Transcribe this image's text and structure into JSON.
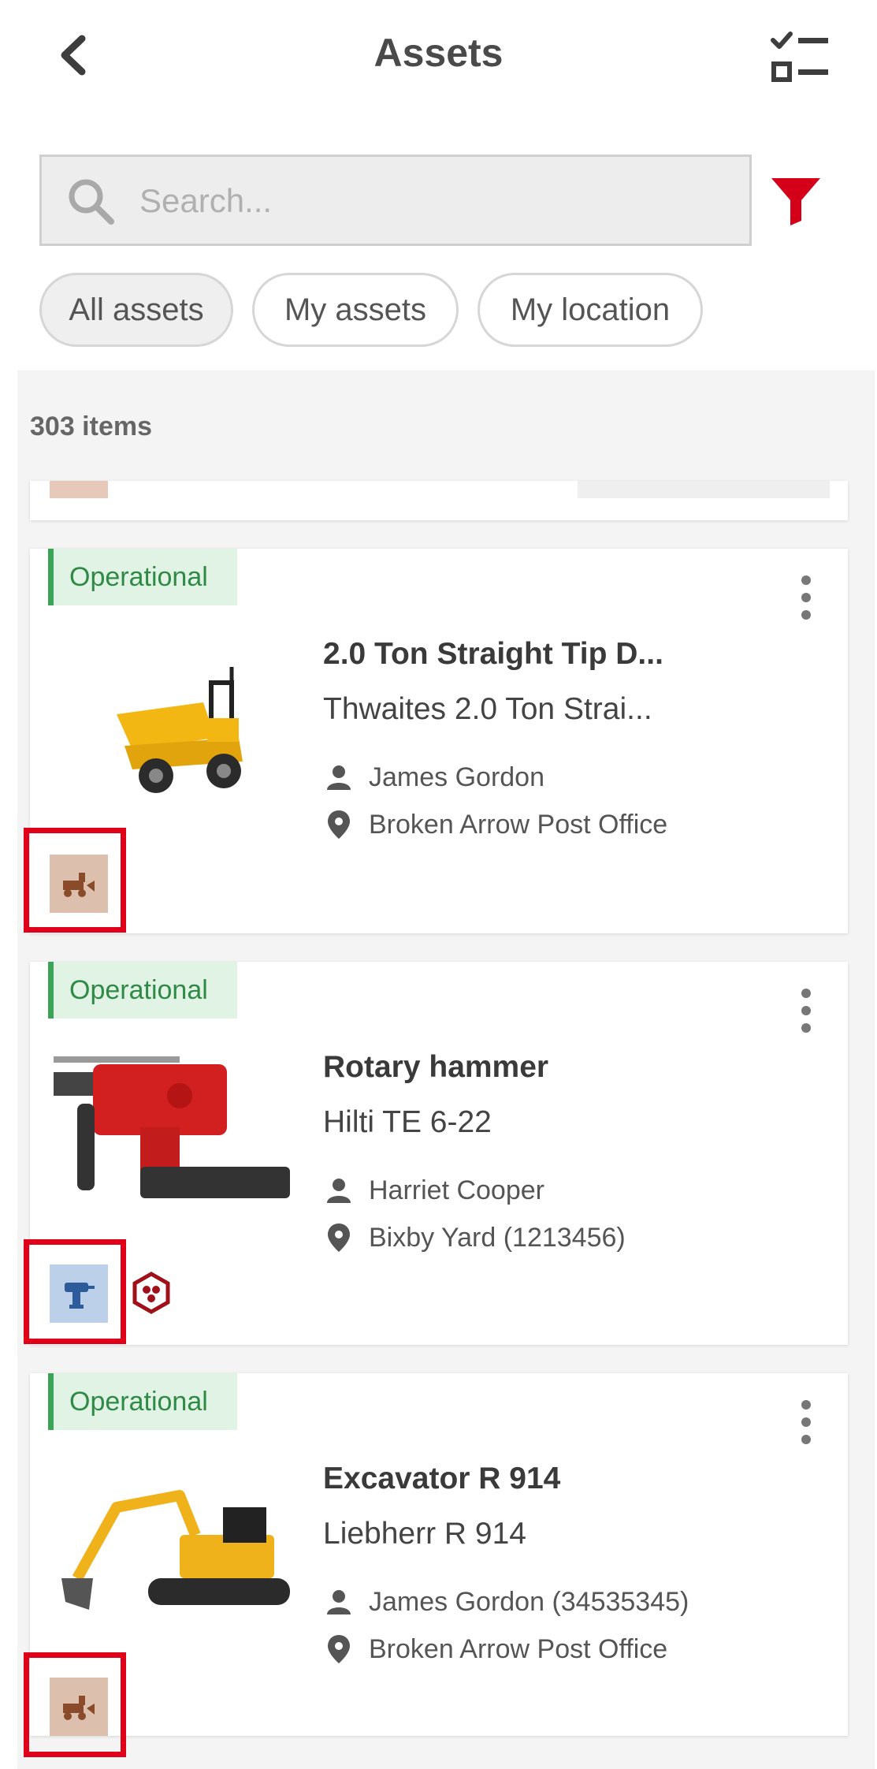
{
  "header": {
    "title": "Assets"
  },
  "search": {
    "placeholder": "Search..."
  },
  "chips": [
    {
      "label": "All assets",
      "active": true
    },
    {
      "label": "My assets",
      "active": false
    },
    {
      "label": "My location",
      "active": false
    }
  ],
  "list": {
    "count_label": "303 items",
    "assets": [
      {
        "status": "Operational",
        "name": "2.0 Ton Straight Tip D...",
        "model": "Thwaites 2.0 Ton Strai...",
        "owner": "James Gordon",
        "location": "Broken Arrow Post Office",
        "category_icon": "dumper-category-icon",
        "thumbnail": "site-dumper-image"
      },
      {
        "status": "Operational",
        "name": "Rotary hammer",
        "model": "Hilti TE 6-22",
        "owner": "Harriet Cooper",
        "location": "Bixby Yard (1213456)",
        "category_icon": "power-tool-category-icon",
        "thumbnail": "rotary-hammer-image",
        "extra_icon": "hexagon-badge-icon"
      },
      {
        "status": "Operational",
        "name": "Excavator R 914",
        "model": "Liebherr R 914",
        "owner": "James Gordon (34535345)",
        "location": "Broken Arrow Post Office",
        "category_icon": "excavator-category-icon",
        "thumbnail": "excavator-image"
      }
    ]
  },
  "colors": {
    "accent_red": "#d4001a",
    "status_green": "#2f8a46",
    "status_bg": "#e0f3e4",
    "highlight_frame": "#e0001a",
    "machine_category_bg": "#dcc0ad",
    "tool_category_bg": "#bcd0ea"
  }
}
